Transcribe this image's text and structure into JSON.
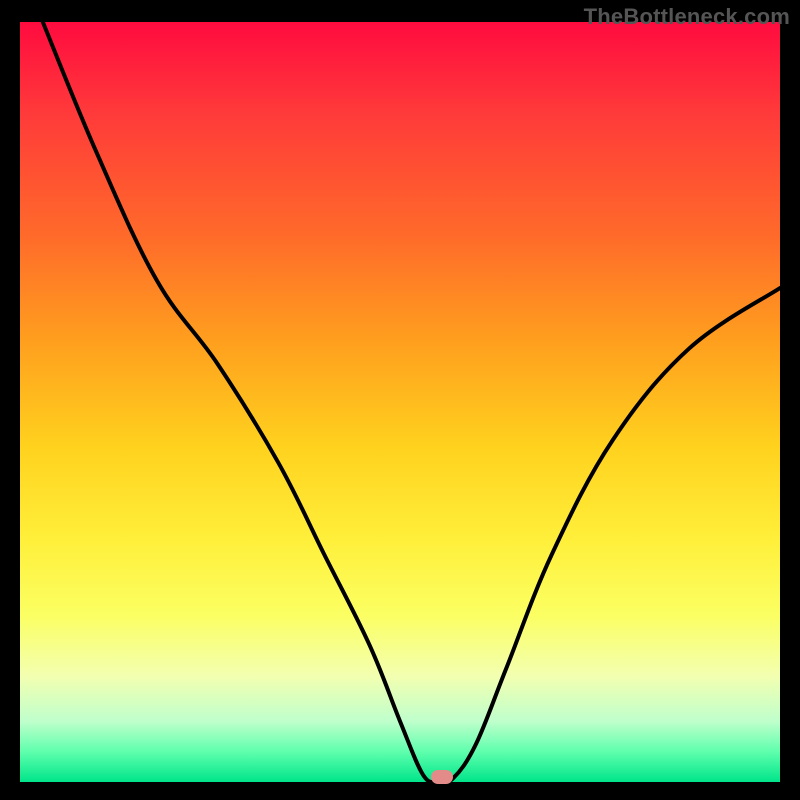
{
  "watermark": "TheBottleneck.com",
  "chart_data": {
    "type": "line",
    "title": "",
    "xlabel": "",
    "ylabel": "",
    "xlim": [
      0,
      100
    ],
    "ylim": [
      0,
      100
    ],
    "grid": false,
    "legend": false,
    "background": "rainbow-gradient",
    "series": [
      {
        "name": "bottleneck-curve",
        "color": "#000000",
        "x": [
          3,
          10,
          18,
          26,
          34,
          40,
          46,
          50,
          53,
          55,
          57,
          60,
          64,
          70,
          78,
          88,
          100
        ],
        "y": [
          100,
          83,
          66,
          55,
          42,
          30,
          18,
          8,
          1,
          0,
          0.5,
          5,
          15,
          30,
          45,
          57,
          65
        ],
        "note": "x is relative horizontal position (%), y is relative height from bottom (%)"
      }
    ],
    "marker": {
      "x": 55.5,
      "y": 0.7,
      "color": "#e28b88"
    },
    "colors": {
      "frame": "#000000",
      "gradient_top": "#ff0b3f",
      "gradient_bottom": "#00e58a"
    }
  }
}
